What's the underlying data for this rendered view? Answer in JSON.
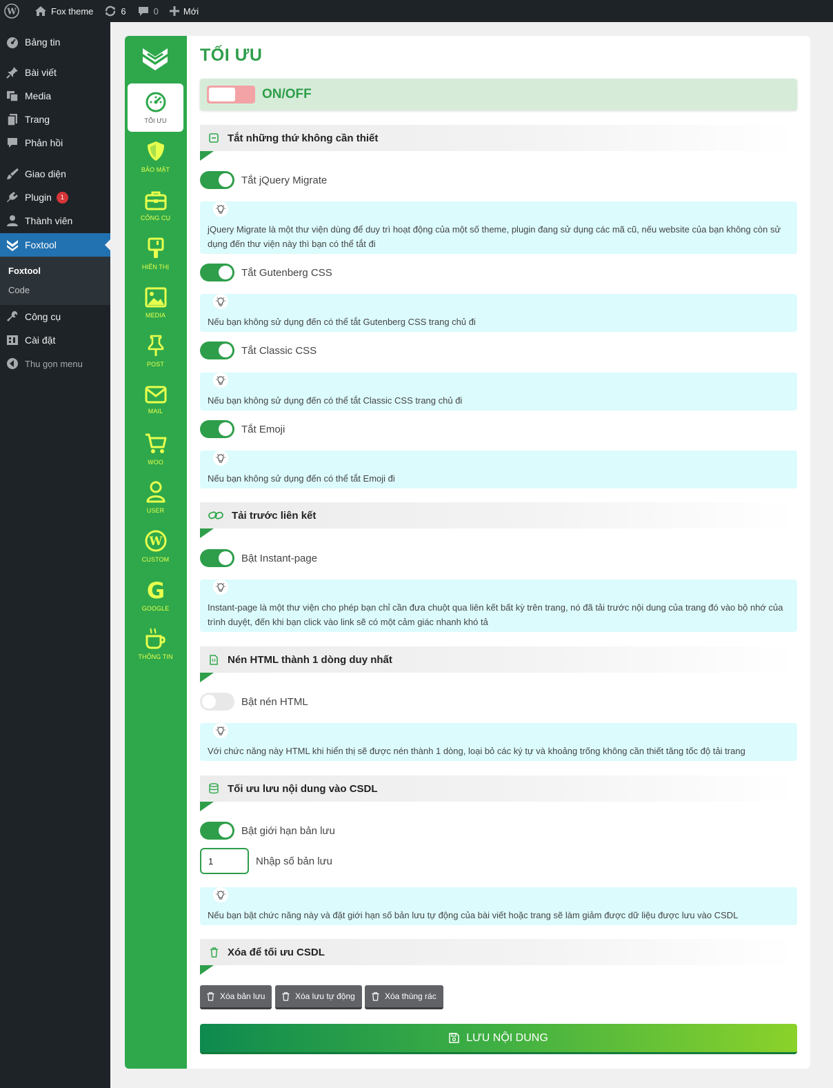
{
  "adminbar": {
    "site_name": "Fox theme",
    "updates_count": "6",
    "comments_count": "0",
    "new_label": "Mới"
  },
  "menu": {
    "items": [
      {
        "label": "Bảng tin",
        "icon": "dashboard-icon"
      },
      {
        "label": "Bài viết",
        "icon": "pin-icon"
      },
      {
        "label": "Media",
        "icon": "media-icon"
      },
      {
        "label": "Trang",
        "icon": "page-icon"
      },
      {
        "label": "Phản hồi",
        "icon": "comment-icon"
      },
      {
        "label": "Giao diện",
        "icon": "brush-icon"
      },
      {
        "label": "Plugin",
        "icon": "plugin-icon",
        "badge": "1"
      },
      {
        "label": "Thành viên",
        "icon": "user-icon"
      },
      {
        "label": "Foxtool",
        "icon": "fox-icon"
      },
      {
        "label": "Công cụ",
        "icon": "wrench-icon"
      },
      {
        "label": "Cài đặt",
        "icon": "settings-icon"
      },
      {
        "label": "Thu gọn menu",
        "icon": "collapse-icon"
      }
    ],
    "submenu": [
      "Foxtool",
      "Code"
    ]
  },
  "foxnav": {
    "items": [
      "TỐI ƯU",
      "BẢO MẬT",
      "CÔNG CỤ",
      "HIỂN THỊ",
      "MEDIA",
      "POST",
      "MAIL",
      "WOO",
      "USER",
      "CUSTOM",
      "GOOGLE",
      "THÔNG TIN"
    ]
  },
  "page": {
    "title": "TỐI ƯU",
    "onoff_label": "ON/OFF"
  },
  "sections": [
    "Tắt những thứ không cần thiết",
    "Tải trước liên kết",
    "Nén HTML thành 1 dòng duy nhất",
    "Tối ưu lưu nội dung vào CSDL",
    "Xóa để tối ưu CSDL"
  ],
  "options": [
    {
      "label": "Tắt jQuery Migrate",
      "enabled": true
    },
    {
      "label": "Tắt Gutenberg CSS",
      "enabled": true
    },
    {
      "label": "Tắt Classic CSS",
      "enabled": true
    },
    {
      "label": "Tắt Emoji",
      "enabled": true
    },
    {
      "label": "Bật Instant-page",
      "enabled": true
    },
    {
      "label": "Bật nén HTML",
      "enabled": false
    },
    {
      "label": "Bật giới hạn bản lưu",
      "enabled": true
    }
  ],
  "hints": [
    "jQuery Migrate là một thư viện dùng để duy trì hoạt động của một số theme, plugin đang sử dụng các mã cũ, nếu website của bạn không còn sử dụng đến thư viện này thì bạn có thể tắt đi",
    "Nếu bạn không sử dụng đến có thể tắt Gutenberg CSS trang chủ đi",
    "Nếu bạn không sử dụng đến có thể tắt Classic CSS trang chủ đi",
    "Nếu bạn không sử dụng đến có thể tắt Emoji đi",
    "Instant-page là một thư viện cho phép bạn chỉ cần đưa chuột qua liên kết bất kỳ trên trang, nó đã tải trước nội dung của trang đó vào bộ nhớ của trình duyệt, đến khi bạn click vào link sẽ có một cảm giác nhanh khó tả",
    "Với chức năng này HTML khi hiển thị sẽ được nén thành 1 dòng, loại bỏ các ký tự và khoảng trống không cần thiết tăng tốc độ tải trang",
    "Nếu bạn bật chức năng này và đặt giới hạn số bản lưu tự động của bài viết hoặc trang sẽ làm giảm được dữ liệu được lưu vào CSDL"
  ],
  "revisions": {
    "value": "1",
    "label": "Nhập số bản lưu"
  },
  "buttons": {
    "delete_revisions": "Xóa bản lưu",
    "delete_autosave": "Xóa lưu tự động",
    "delete_trash": "Xóa thùng rác",
    "save": "LƯU NỘI DUNG"
  },
  "colors": {
    "brand_green": "#2ea84b",
    "nav_text": "#e8ff4e",
    "wp_blue": "#2271b1",
    "hint_bg": "#dcfbfd"
  }
}
